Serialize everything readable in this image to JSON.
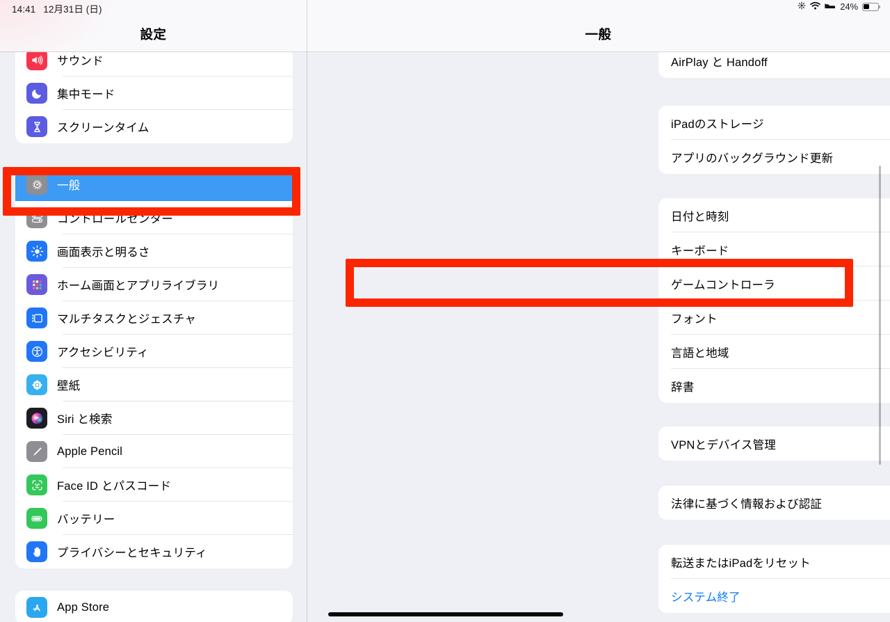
{
  "status_bar": {
    "time": "14:41",
    "date": "12月31日 (日)",
    "icons": [
      "sparkle-icon",
      "wifi-icon",
      "bed-icon"
    ],
    "battery_percent": "24%",
    "battery_level": 24
  },
  "sidebar": {
    "title": "設定",
    "groups": [
      {
        "items": [
          {
            "label": "サウンド",
            "icon": "speaker-icon",
            "icon_bg": "#f7344b",
            "selected": false
          },
          {
            "label": "集中モード",
            "icon": "moon-icon",
            "icon_bg": "#5b5ce2",
            "selected": false
          },
          {
            "label": "スクリーンタイム",
            "icon": "hourglass-icon",
            "icon_bg": "#5b5ce2",
            "selected": false
          }
        ]
      },
      {
        "items": [
          {
            "label": "一般",
            "icon": "gear-icon",
            "icon_bg": "#8e8e93",
            "selected": true
          },
          {
            "label": "コントロールセンター",
            "icon": "control-center-icon",
            "icon_bg": "#8e8e93",
            "selected": false
          },
          {
            "label": "画面表示と明るさ",
            "icon": "brightness-icon",
            "icon_bg": "#2176f6",
            "selected": false
          },
          {
            "label": "ホーム画面とアプリライブラリ",
            "icon": "app-grid-icon",
            "icon_bg": "#6a5ae0",
            "selected": false
          },
          {
            "label": "マルチタスクとジェスチャ",
            "icon": "multitask-icon",
            "icon_bg": "#2176f6",
            "selected": false
          },
          {
            "label": "アクセシビリティ",
            "icon": "accessibility-icon",
            "icon_bg": "#2176f6",
            "selected": false
          },
          {
            "label": "壁紙",
            "icon": "wallpaper-icon",
            "icon_bg": "#37b0f0",
            "selected": false
          },
          {
            "label": "Siri と検索",
            "icon": "siri-icon",
            "icon_bg": "#1c1c22",
            "selected": false
          },
          {
            "label": "Apple Pencil",
            "icon": "pencil-icon",
            "icon_bg": "#8e8e93",
            "selected": false
          },
          {
            "label": "Face ID とパスコード",
            "icon": "faceid-icon",
            "icon_bg": "#34c759",
            "selected": false
          },
          {
            "label": "バッテリー",
            "icon": "battery-icon",
            "icon_bg": "#34c759",
            "selected": false
          },
          {
            "label": "プライバシーとセキュリティ",
            "icon": "hand-icon",
            "icon_bg": "#2176f6",
            "selected": false
          }
        ]
      },
      {
        "items": [
          {
            "label": "App Store",
            "icon": "appstore-icon",
            "icon_bg": "#2aa7ef",
            "selected": false
          }
        ]
      }
    ]
  },
  "general_panel": {
    "title": "一般",
    "groups": [
      {
        "items": [
          {
            "label": "AirPlay と Handoff",
            "chevron": true
          }
        ]
      },
      {
        "items": [
          {
            "label": "iPadのストレージ",
            "chevron": true
          },
          {
            "label": "アプリのバックグラウンド更新",
            "chevron": true
          }
        ]
      },
      {
        "items": [
          {
            "label": "日付と時刻",
            "chevron": true
          },
          {
            "label": "キーボード",
            "chevron": true
          },
          {
            "label": "ゲームコントローラ",
            "chevron": true,
            "highlighted": true
          },
          {
            "label": "フォント",
            "chevron": true
          },
          {
            "label": "言語と地域",
            "chevron": true
          },
          {
            "label": "辞書",
            "chevron": true
          }
        ]
      },
      {
        "items": [
          {
            "label": "VPNとデバイス管理",
            "chevron": true
          }
        ]
      },
      {
        "items": [
          {
            "label": "法律に基づく情報および認証",
            "chevron": true
          }
        ]
      },
      {
        "items": [
          {
            "label": "転送またはiPadをリセット",
            "chevron": true
          },
          {
            "label": "システム終了",
            "chevron": false,
            "style": "link"
          }
        ]
      }
    ]
  },
  "annotations": {
    "highlight_color": "#fb2600",
    "boxes": [
      {
        "target": "sidebar-item-general"
      },
      {
        "target": "general-row-game-controller"
      }
    ]
  },
  "colors": {
    "accent_blue": "#3d9bf5",
    "link_blue": "#0a7cf3",
    "annotation_red": "#fb2600",
    "page_bg": "#eff0f5",
    "card_bg": "#ffffff"
  }
}
